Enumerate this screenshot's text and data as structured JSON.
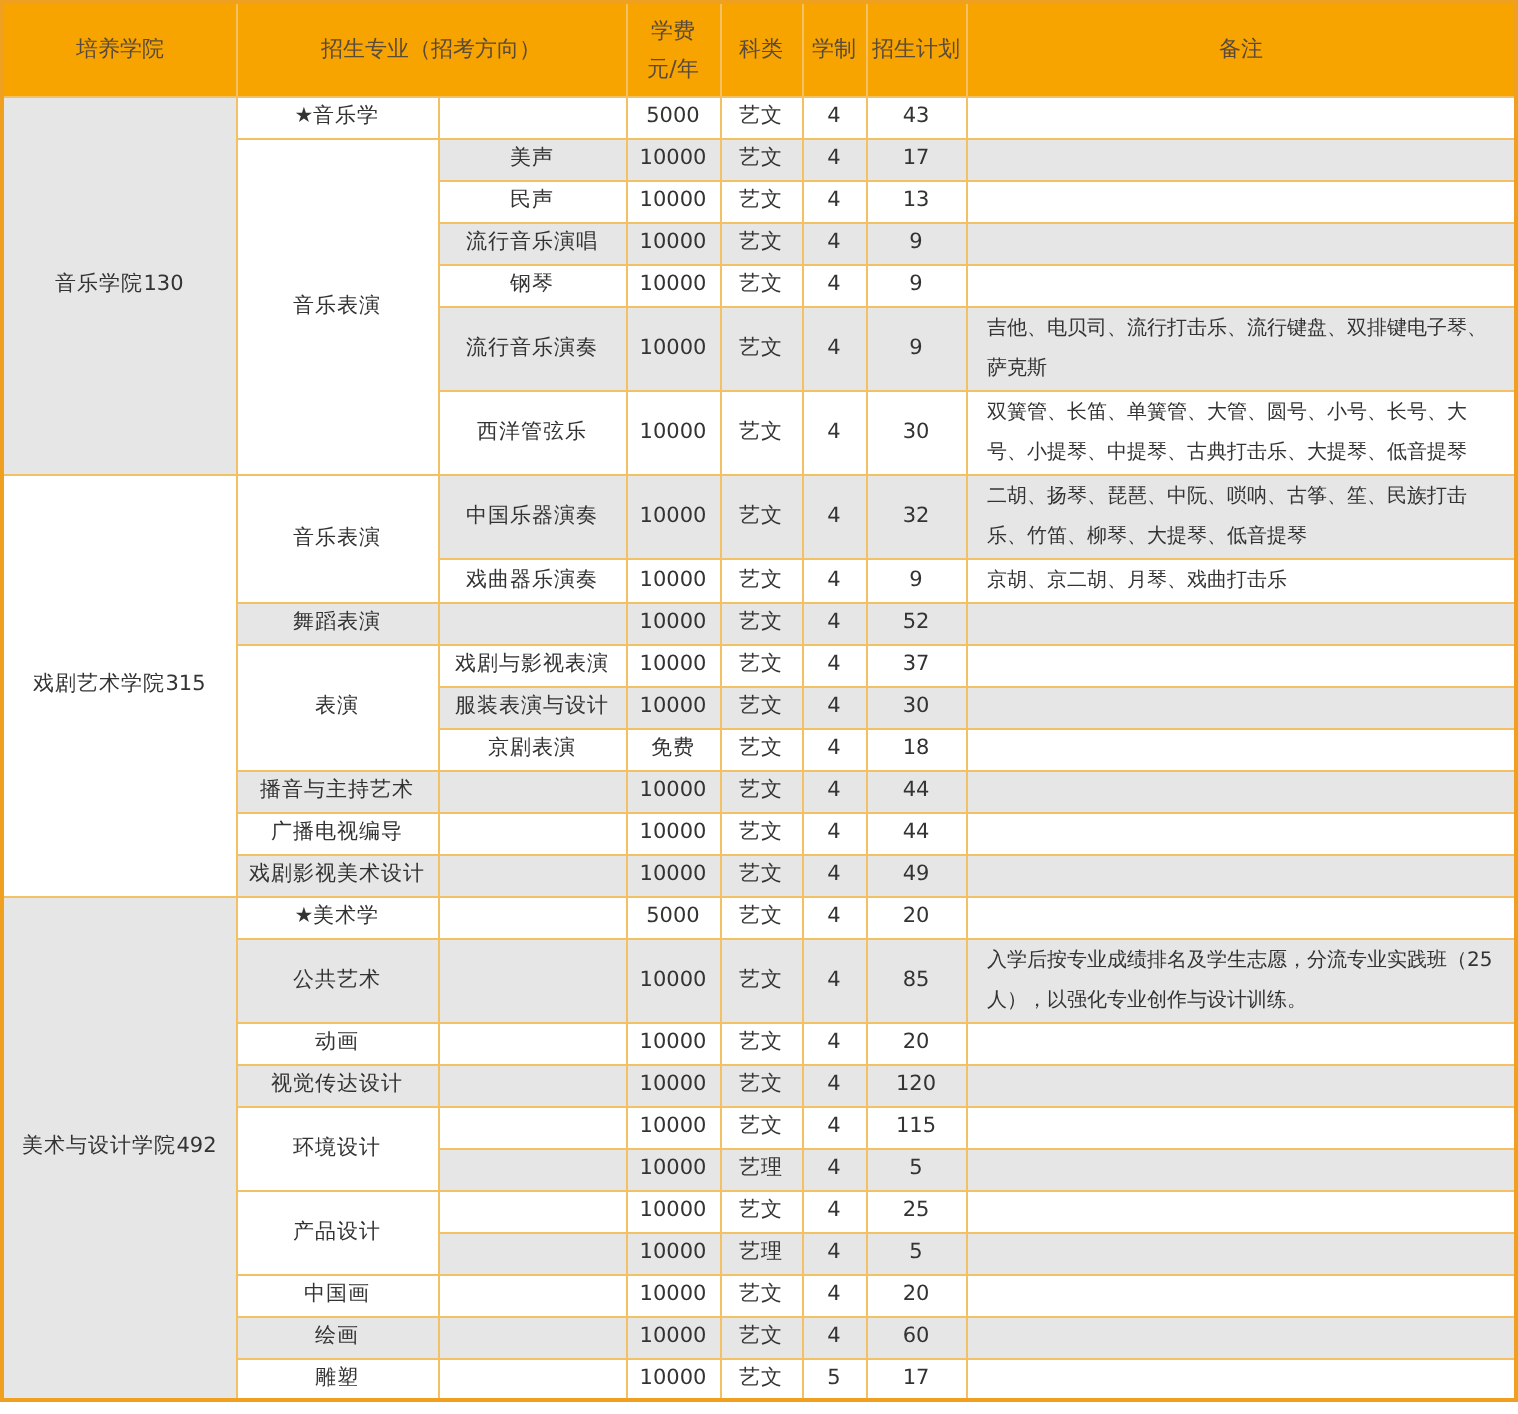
{
  "table": {
    "columns": [
      {
        "label": "培养学院"
      },
      {
        "label": "招生专业（招考方向）"
      },
      {
        "label": "学费",
        "unit": "元/年"
      },
      {
        "label": "科类"
      },
      {
        "label": "学制"
      },
      {
        "label": "招生计划"
      },
      {
        "label": "备注"
      }
    ],
    "colleges": [
      {
        "name": "音乐学院130",
        "majors": [
          {
            "name": "★音乐学",
            "rows": [
              {
                "fee": "5000",
                "category": "艺文",
                "years": "4",
                "plan": "43"
              }
            ]
          },
          {
            "name": "音乐表演",
            "rows": [
              {
                "direction": "美声",
                "fee": "10000",
                "category": "艺文",
                "years": "4",
                "plan": "17"
              },
              {
                "direction": "民声",
                "fee": "10000",
                "category": "艺文",
                "years": "4",
                "plan": "13"
              },
              {
                "direction": "流行音乐演唱",
                "fee": "10000",
                "category": "艺文",
                "years": "4",
                "plan": "9"
              },
              {
                "direction": "钢琴",
                "fee": "10000",
                "category": "艺文",
                "years": "4",
                "plan": "9"
              },
              {
                "direction": "流行音乐演奏",
                "fee": "10000",
                "category": "艺文",
                "years": "4",
                "plan": "9",
                "note": "吉他、电贝司、流行打击乐、流行键盘、双排键电子琴、萨克斯"
              },
              {
                "direction": "西洋管弦乐",
                "fee": "10000",
                "category": "艺文",
                "years": "4",
                "plan": "30",
                "note": "双簧管、长笛、单簧管、大管、圆号、小号、长号、大号、小提琴、中提琴、古典打击乐、大提琴、低音提琴"
              }
            ]
          }
        ]
      },
      {
        "name": "戏剧艺术学院315",
        "majors": [
          {
            "name": "音乐表演",
            "rows": [
              {
                "direction": "中国乐器演奏",
                "fee": "10000",
                "category": "艺文",
                "years": "4",
                "plan": "32",
                "note": "二胡、扬琴、琵琶、中阮、唢呐、古筝、笙、民族打击乐、竹笛、柳琴、大提琴、低音提琴"
              },
              {
                "direction": "戏曲器乐演奏",
                "fee": "10000",
                "category": "艺文",
                "years": "4",
                "plan": "9",
                "note": "京胡、京二胡、月琴、戏曲打击乐"
              }
            ]
          },
          {
            "name": "舞蹈表演",
            "rows": [
              {
                "fee": "10000",
                "category": "艺文",
                "years": "4",
                "plan": "52"
              }
            ]
          },
          {
            "name": "表演",
            "rows": [
              {
                "direction": "戏剧与影视表演",
                "fee": "10000",
                "category": "艺文",
                "years": "4",
                "plan": "37"
              },
              {
                "direction": "服装表演与设计",
                "fee": "10000",
                "category": "艺文",
                "years": "4",
                "plan": "30"
              },
              {
                "direction": "京剧表演",
                "fee": "免费",
                "category": "艺文",
                "years": "4",
                "plan": "18"
              }
            ]
          },
          {
            "name": "播音与主持艺术",
            "rows": [
              {
                "fee": "10000",
                "category": "艺文",
                "years": "4",
                "plan": "44"
              }
            ]
          },
          {
            "name": "广播电视编导",
            "rows": [
              {
                "fee": "10000",
                "category": "艺文",
                "years": "4",
                "plan": "44"
              }
            ]
          },
          {
            "name": "戏剧影视美术设计",
            "rows": [
              {
                "fee": "10000",
                "category": "艺文",
                "years": "4",
                "plan": "49"
              }
            ]
          }
        ]
      },
      {
        "name": "美术与设计学院492",
        "majors": [
          {
            "name": "★美术学",
            "rows": [
              {
                "fee": "5000",
                "category": "艺文",
                "years": "4",
                "plan": "20"
              }
            ]
          },
          {
            "name": "公共艺术",
            "rows": [
              {
                "fee": "10000",
                "category": "艺文",
                "years": "4",
                "plan": "85",
                "note": "入学后按专业成绩排名及学生志愿，分流专业实践班（25人），以强化专业创作与设计训练。"
              }
            ]
          },
          {
            "name": "动画",
            "rows": [
              {
                "fee": "10000",
                "category": "艺文",
                "years": "4",
                "plan": "20"
              }
            ]
          },
          {
            "name": "视觉传达设计",
            "rows": [
              {
                "fee": "10000",
                "category": "艺文",
                "years": "4",
                "plan": "120"
              }
            ]
          },
          {
            "name": "环境设计",
            "rows": [
              {
                "fee": "10000",
                "category": "艺文",
                "years": "4",
                "plan": "115"
              },
              {
                "fee": "10000",
                "category": "艺理",
                "years": "4",
                "plan": "5"
              }
            ]
          },
          {
            "name": "产品设计",
            "rows": [
              {
                "fee": "10000",
                "category": "艺文",
                "years": "4",
                "plan": "25"
              },
              {
                "fee": "10000",
                "category": "艺理",
                "years": "4",
                "plan": "5"
              }
            ]
          },
          {
            "name": "中国画",
            "rows": [
              {
                "fee": "10000",
                "category": "艺文",
                "years": "4",
                "plan": "20"
              }
            ]
          },
          {
            "name": "绘画",
            "rows": [
              {
                "fee": "10000",
                "category": "艺文",
                "years": "4",
                "plan": "60"
              }
            ]
          },
          {
            "name": "雕塑",
            "rows": [
              {
                "fee": "10000",
                "category": "艺文",
                "years": "5",
                "plan": "17"
              }
            ]
          }
        ]
      }
    ]
  }
}
